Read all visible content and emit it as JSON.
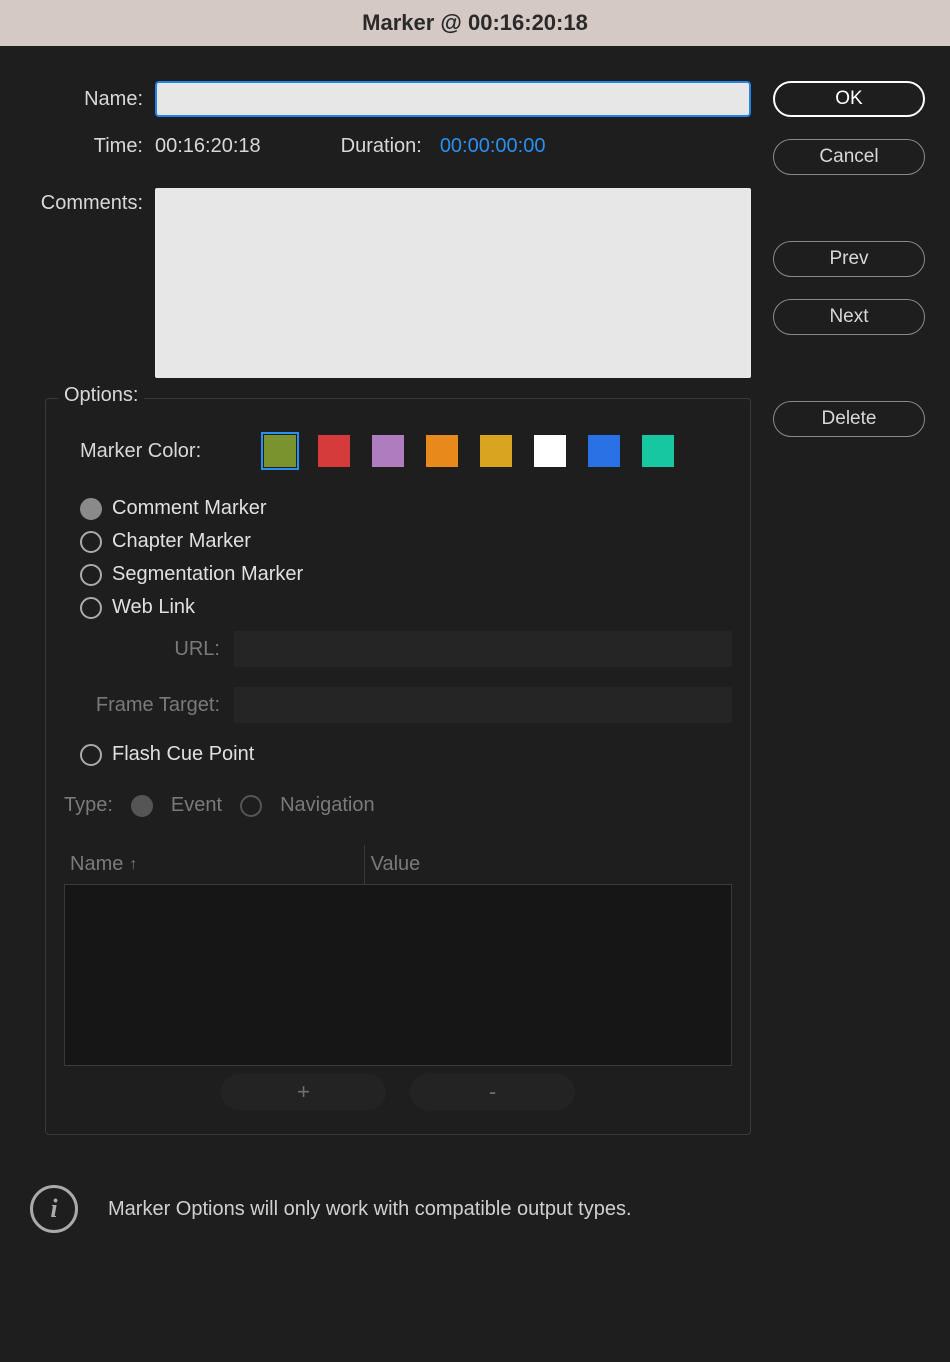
{
  "title": "Marker @ 00:16:20:18",
  "labels": {
    "name": "Name:",
    "time": "Time:",
    "duration": "Duration:",
    "comments": "Comments:",
    "options": "Options:",
    "marker_color": "Marker Color:",
    "url": "URL:",
    "frame_target": "Frame Target:",
    "type": "Type:"
  },
  "values": {
    "name": "",
    "time": "00:16:20:18",
    "duration": "00:00:00:00",
    "comments": "",
    "url": "",
    "frame_target": ""
  },
  "buttons": {
    "ok": "OK",
    "cancel": "Cancel",
    "prev": "Prev",
    "next": "Next",
    "delete": "Delete",
    "plus": "+",
    "minus": "-"
  },
  "colors": [
    {
      "name": "olive",
      "value": "#79942e",
      "selected": true
    },
    {
      "name": "red",
      "value": "#d63b3b",
      "selected": false
    },
    {
      "name": "purple",
      "value": "#b07cc0",
      "selected": false
    },
    {
      "name": "orange",
      "value": "#e78a1b",
      "selected": false
    },
    {
      "name": "gold",
      "value": "#d9a520",
      "selected": false
    },
    {
      "name": "white",
      "value": "#ffffff",
      "selected": false
    },
    {
      "name": "blue",
      "value": "#2a71e6",
      "selected": false
    },
    {
      "name": "teal",
      "value": "#17c7a1",
      "selected": false
    }
  ],
  "marker_types": {
    "comment": "Comment Marker",
    "chapter": "Chapter Marker",
    "segmentation": "Segmentation Marker",
    "weblink": "Web Link",
    "flash": "Flash Cue Point",
    "selected": "comment"
  },
  "cue_type": {
    "event": "Event",
    "navigation": "Navigation",
    "selected": "event"
  },
  "table": {
    "columns": {
      "name": "Name",
      "value": "Value"
    },
    "rows": []
  },
  "info": "Marker Options will only work with compatible output types."
}
